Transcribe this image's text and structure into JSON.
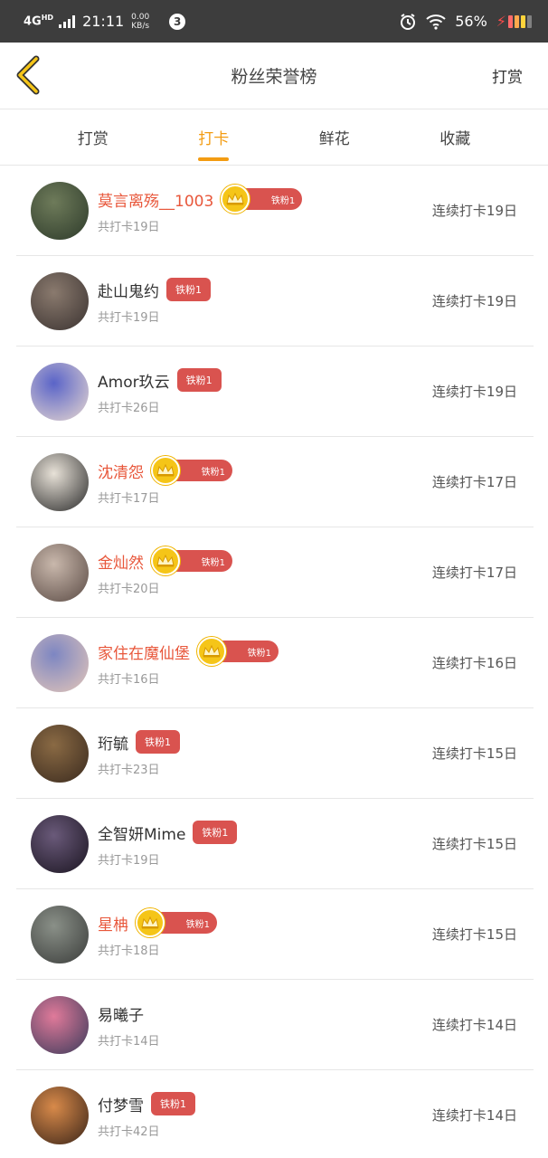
{
  "status": {
    "network": "4G",
    "hd": "HD",
    "time": "21:11",
    "speed_value": "0.00",
    "speed_unit": "KB/s",
    "notif_count": "3",
    "battery": "56%"
  },
  "header": {
    "title": "粉丝荣誉榜",
    "right": "打赏"
  },
  "tabs": [
    {
      "label": "打赏"
    },
    {
      "label": "打卡"
    },
    {
      "label": "鲜花"
    },
    {
      "label": "收藏"
    }
  ],
  "active_tab": "打卡",
  "colors": {
    "accent": "#f39c12",
    "highlight": "#e8573b",
    "badge": "#d9534f",
    "crown": "#f5c518"
  },
  "fans": [
    {
      "name": "莫言离殇__1003",
      "badge": "铁粉1",
      "crown": true,
      "total": "共打卡19日",
      "streak": "连续打卡19日",
      "avatar": [
        "#6e7b5a",
        "#2d3a2a"
      ]
    },
    {
      "name": "赴山鬼约",
      "badge": "铁粉1",
      "crown": false,
      "total": "共打卡19日",
      "streak": "连续打卡19日",
      "avatar": [
        "#8a7a6e",
        "#3a3230"
      ]
    },
    {
      "name": "Amor玖云",
      "badge": "铁粉1",
      "crown": false,
      "total": "共打卡26日",
      "streak": "连续打卡19日",
      "avatar": [
        "#5a64c8",
        "#e8d8d0"
      ]
    },
    {
      "name": "沈清怨",
      "badge": "铁粉1",
      "crown": true,
      "total": "共打卡17日",
      "streak": "连续打卡17日",
      "avatar": [
        "#e8e2d8",
        "#2a2a2a"
      ]
    },
    {
      "name": "金灿然",
      "badge": "铁粉1",
      "crown": true,
      "total": "共打卡20日",
      "streak": "连续打卡17日",
      "avatar": [
        "#c9b8ac",
        "#5a4a44"
      ]
    },
    {
      "name": "家住在魔仙堡",
      "badge": "铁粉1",
      "crown": true,
      "total": "共打卡16日",
      "streak": "连续打卡16日",
      "avatar": [
        "#7d86c2",
        "#e4c6b8"
      ]
    },
    {
      "name": "珩毓",
      "badge": "铁粉1",
      "crown": false,
      "total": "共打卡23日",
      "streak": "连续打卡15日",
      "avatar": [
        "#8a6a44",
        "#3a2a1e"
      ]
    },
    {
      "name": "全智妍Mime",
      "badge": "铁粉1",
      "crown": false,
      "total": "共打卡19日",
      "streak": "连续打卡15日",
      "avatar": [
        "#6a5a7a",
        "#1a1420"
      ]
    },
    {
      "name": "星柟",
      "badge": "铁粉1",
      "crown": true,
      "total": "共打卡18日",
      "streak": "连续打卡15日",
      "avatar": [
        "#8a9088",
        "#3a3c3a"
      ]
    },
    {
      "name": "易曦子",
      "badge": "",
      "crown": false,
      "total": "共打卡14日",
      "streak": "连续打卡14日",
      "avatar": [
        "#e07a9a",
        "#3a3a5a"
      ]
    },
    {
      "name": "付梦雪",
      "badge": "铁粉1",
      "crown": false,
      "total": "共打卡42日",
      "streak": "连续打卡14日",
      "avatar": [
        "#d88a4a",
        "#3a2418"
      ]
    }
  ]
}
